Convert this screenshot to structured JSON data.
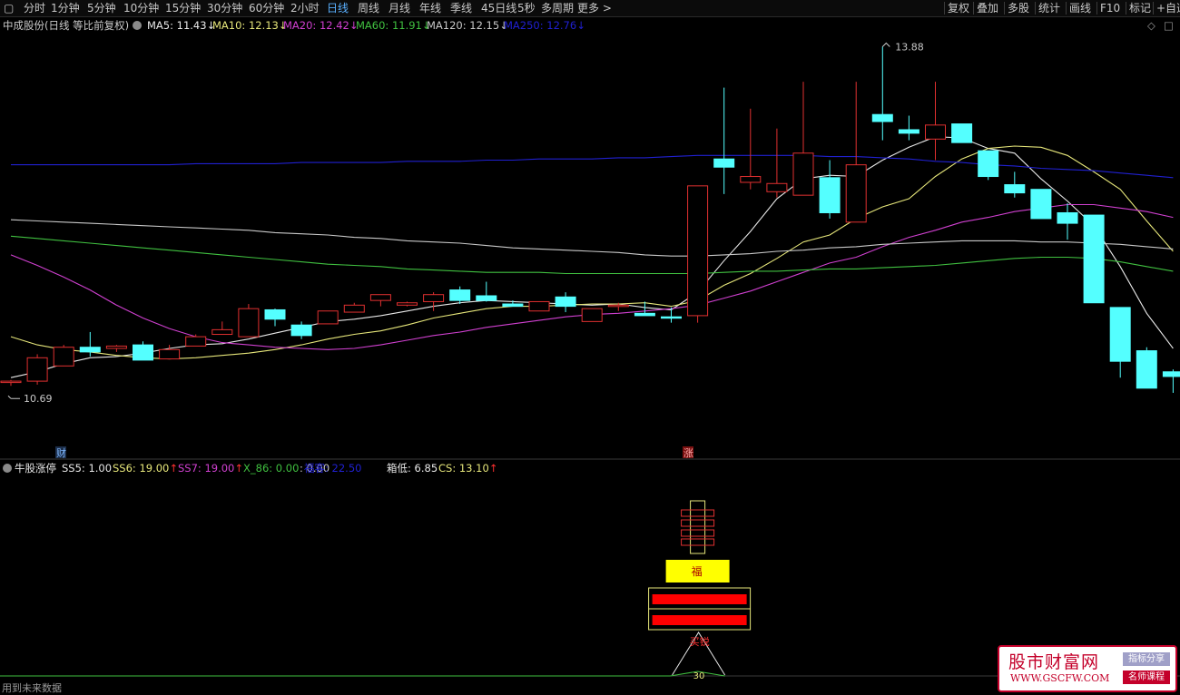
{
  "toolbar": {
    "periods": [
      "分时",
      "1分钟",
      "5分钟",
      "10分钟",
      "15分钟",
      "30分钟",
      "60分钟",
      "2小时",
      "日线",
      "周线",
      "月线",
      "年线",
      "季线",
      "45日线",
      "5秒",
      "多周期",
      "更多 >"
    ],
    "active_period": "日线",
    "right": [
      "复权",
      "叠加",
      "多股",
      "统计",
      "画线",
      "F10",
      "标记",
      "+自选"
    ]
  },
  "main_legend": {
    "title": "中成股份(日线 等比前复权)",
    "items": [
      {
        "text": "MA5: 11.43",
        "arrow": "↓",
        "color": "#e8e8e8"
      },
      {
        "text": "MA10: 12.13",
        "arrow": "↓",
        "color": "#e6e67a"
      },
      {
        "text": "MA20: 12.42",
        "arrow": "↓",
        "color": "#d040d0"
      },
      {
        "text": "MA60: 11.91",
        "arrow": "↓",
        "color": "#40c040"
      },
      {
        "text": "MA120: 12.15",
        "arrow": "↓",
        "color": "#c8c8c8"
      },
      {
        "text": "MA250: 12.76",
        "arrow": "↓",
        "color": "#2020d0"
      }
    ]
  },
  "sub_legend": {
    "title": "牛股涨停",
    "items": [
      {
        "text": "SS5: 1.00",
        "color": "#e8e8e8",
        "arrow": ""
      },
      {
        "text": "SS6: 19.00",
        "color": "#e6e67a",
        "arrow": "↑"
      },
      {
        "text": "SS7: 19.00",
        "color": "#d040d0",
        "arrow": "↑"
      },
      {
        "text": "X_86: 0.00",
        "color": "#40c040",
        "arrow": ""
      },
      {
        "text": ": 0.00",
        "color": "#c8c8c8",
        "arrow": ""
      },
      {
        "text": "福客: 22.50",
        "color": "#2020d0",
        "arrow": ""
      },
      {
        "text": "箱低: 6.85",
        "color": "#e8e8e8",
        "arrow": ""
      },
      {
        "text": "CS: 13.10",
        "color": "#e6e67a",
        "arrow": "↑"
      }
    ]
  },
  "annotations": {
    "high_label": "13.88",
    "low_label": "10.69",
    "cai": "财",
    "zhang": "涨",
    "buy": "买锐",
    "num30": "30",
    "fu": "福"
  },
  "status_text": "用到未来数据",
  "watermark": {
    "cn": "股市财富网",
    "url": "WWW.GSCFW.COM",
    "tag1": "指标分享",
    "tag2": "名师课程"
  },
  "colors": {
    "up": "#e03030",
    "down": "#54ffff",
    "bg": "#000000"
  },
  "chart_data": {
    "type": "candlestick",
    "title": "中成股份(日线 等比前复权)",
    "ylim": [
      10.4,
      14.0
    ],
    "candles": [
      {
        "o": 11.02,
        "h": 11.03,
        "l": 10.98,
        "c": 11.02
      },
      {
        "o": 11.02,
        "h": 11.25,
        "l": 10.99,
        "c": 11.22
      },
      {
        "o": 11.15,
        "h": 11.33,
        "l": 11.15,
        "c": 11.31
      },
      {
        "o": 11.31,
        "h": 11.44,
        "l": 11.23,
        "c": 11.27
      },
      {
        "o": 11.3,
        "h": 11.33,
        "l": 11.27,
        "c": 11.32
      },
      {
        "o": 11.33,
        "h": 11.36,
        "l": 11.2,
        "c": 11.2
      },
      {
        "o": 11.21,
        "h": 11.33,
        "l": 11.21,
        "c": 11.29
      },
      {
        "o": 11.32,
        "h": 11.42,
        "l": 11.32,
        "c": 11.4
      },
      {
        "o": 11.42,
        "h": 11.53,
        "l": 11.42,
        "c": 11.46
      },
      {
        "o": 11.4,
        "h": 11.68,
        "l": 11.4,
        "c": 11.64
      },
      {
        "o": 11.63,
        "h": 11.64,
        "l": 11.49,
        "c": 11.55
      },
      {
        "o": 11.5,
        "h": 11.53,
        "l": 11.38,
        "c": 11.41
      },
      {
        "o": 11.51,
        "h": 11.62,
        "l": 11.51,
        "c": 11.62
      },
      {
        "o": 11.61,
        "h": 11.69,
        "l": 11.61,
        "c": 11.67
      },
      {
        "o": 11.71,
        "h": 11.76,
        "l": 11.66,
        "c": 11.76
      },
      {
        "o": 11.67,
        "h": 11.7,
        "l": 11.66,
        "c": 11.69
      },
      {
        "o": 11.7,
        "h": 11.78,
        "l": 11.62,
        "c": 11.76
      },
      {
        "o": 11.8,
        "h": 11.83,
        "l": 11.68,
        "c": 11.71
      },
      {
        "o": 11.75,
        "h": 11.87,
        "l": 11.7,
        "c": 11.71
      },
      {
        "o": 11.68,
        "h": 11.71,
        "l": 11.66,
        "c": 11.66
      },
      {
        "o": 11.62,
        "h": 11.7,
        "l": 11.62,
        "c": 11.7
      },
      {
        "o": 11.74,
        "h": 11.78,
        "l": 11.61,
        "c": 11.66
      },
      {
        "o": 11.53,
        "h": 11.64,
        "l": 11.53,
        "c": 11.64
      },
      {
        "o": 11.66,
        "h": 11.69,
        "l": 11.62,
        "c": 11.67
      },
      {
        "o": 11.6,
        "h": 11.7,
        "l": 11.58,
        "c": 11.58
      },
      {
        "o": 11.57,
        "h": 11.65,
        "l": 11.52,
        "c": 11.56
      },
      {
        "o": 11.58,
        "h": 12.69,
        "l": 11.52,
        "c": 12.69
      },
      {
        "o": 12.92,
        "h": 13.53,
        "l": 12.62,
        "c": 12.85
      },
      {
        "o": 12.72,
        "h": 13.35,
        "l": 12.66,
        "c": 12.77
      },
      {
        "o": 12.64,
        "h": 13.18,
        "l": 12.59,
        "c": 12.71
      },
      {
        "o": 12.61,
        "h": 13.58,
        "l": 12.61,
        "c": 12.97
      },
      {
        "o": 12.76,
        "h": 12.91,
        "l": 12.41,
        "c": 12.46
      },
      {
        "o": 12.38,
        "h": 13.58,
        "l": 12.38,
        "c": 12.87
      },
      {
        "o": 13.3,
        "h": 13.88,
        "l": 13.08,
        "c": 13.24
      },
      {
        "o": 13.17,
        "h": 13.29,
        "l": 13.08,
        "c": 13.14
      },
      {
        "o": 13.09,
        "h": 13.58,
        "l": 12.91,
        "c": 13.21
      },
      {
        "o": 13.22,
        "h": 13.22,
        "l": 13.06,
        "c": 13.06
      },
      {
        "o": 12.99,
        "h": 12.99,
        "l": 12.74,
        "c": 12.77
      },
      {
        "o": 12.7,
        "h": 12.81,
        "l": 12.59,
        "c": 12.63
      },
      {
        "o": 12.66,
        "h": 12.66,
        "l": 12.41,
        "c": 12.41
      },
      {
        "o": 12.46,
        "h": 12.54,
        "l": 12.23,
        "c": 12.37
      },
      {
        "o": 12.44,
        "h": 12.44,
        "l": 11.69,
        "c": 11.69
      },
      {
        "o": 11.65,
        "h": 11.65,
        "l": 11.05,
        "c": 11.19
      },
      {
        "o": 11.28,
        "h": 11.31,
        "l": 10.96,
        "c": 10.96
      },
      {
        "o": 11.1,
        "h": 11.12,
        "l": 10.92,
        "c": 11.06
      }
    ],
    "ma_series": [
      {
        "name": "MA5",
        "color": "#e8e8e8",
        "values": [
          11.05,
          11.1,
          11.17,
          11.22,
          11.23,
          11.26,
          11.3,
          11.33,
          11.34,
          11.38,
          11.43,
          11.48,
          11.53,
          11.55,
          11.58,
          11.62,
          11.66,
          11.69,
          11.71,
          11.7,
          11.69,
          11.68,
          11.67,
          11.68,
          11.65,
          11.63,
          11.78,
          12.05,
          12.3,
          12.58,
          12.75,
          12.78,
          12.77,
          12.91,
          13.02,
          13.11,
          13.1,
          13.01,
          12.97,
          12.75,
          12.56,
          12.35,
          12.0,
          11.6,
          11.3
        ]
      },
      {
        "name": "MA10",
        "color": "#e6e67a",
        "values": [
          11.4,
          11.33,
          11.29,
          11.27,
          11.24,
          11.22,
          11.21,
          11.22,
          11.24,
          11.26,
          11.29,
          11.33,
          11.38,
          11.42,
          11.45,
          11.5,
          11.56,
          11.6,
          11.64,
          11.66,
          11.66,
          11.67,
          11.68,
          11.68,
          11.69,
          11.66,
          11.71,
          11.84,
          11.94,
          12.07,
          12.21,
          12.27,
          12.41,
          12.51,
          12.58,
          12.77,
          12.92,
          13.01,
          13.03,
          13.02,
          12.95,
          12.81,
          12.66,
          12.39,
          12.13
        ]
      },
      {
        "name": "MA20",
        "color": "#d040d0",
        "values": [
          12.1,
          12.01,
          11.91,
          11.8,
          11.67,
          11.56,
          11.47,
          11.4,
          11.35,
          11.33,
          11.31,
          11.3,
          11.29,
          11.3,
          11.33,
          11.37,
          11.41,
          11.44,
          11.48,
          11.51,
          11.54,
          11.57,
          11.59,
          11.6,
          11.62,
          11.64,
          11.67,
          11.73,
          11.79,
          11.87,
          11.95,
          12.03,
          12.08,
          12.17,
          12.25,
          12.31,
          12.38,
          12.42,
          12.47,
          12.5,
          12.53,
          12.53,
          12.5,
          12.47,
          12.42
        ]
      },
      {
        "name": "MA60",
        "color": "#40c040",
        "values": [
          12.26,
          12.24,
          12.22,
          12.2,
          12.18,
          12.16,
          12.14,
          12.12,
          12.1,
          12.08,
          12.06,
          12.04,
          12.02,
          12.01,
          12.0,
          11.98,
          11.97,
          11.96,
          11.95,
          11.95,
          11.95,
          11.94,
          11.94,
          11.94,
          11.94,
          11.94,
          11.94,
          11.95,
          11.96,
          11.96,
          11.97,
          11.98,
          11.98,
          11.99,
          12.0,
          12.01,
          12.03,
          12.05,
          12.07,
          12.08,
          12.08,
          12.07,
          12.04,
          12.0,
          11.96
        ]
      },
      {
        "name": "MA120",
        "color": "#c8c8c8",
        "values": [
          12.4,
          12.39,
          12.38,
          12.37,
          12.36,
          12.35,
          12.34,
          12.33,
          12.32,
          12.31,
          12.29,
          12.28,
          12.27,
          12.25,
          12.24,
          12.22,
          12.21,
          12.2,
          12.18,
          12.16,
          12.15,
          12.14,
          12.13,
          12.12,
          12.1,
          12.09,
          12.09,
          12.1,
          12.11,
          12.13,
          12.14,
          12.16,
          12.17,
          12.19,
          12.2,
          12.21,
          12.22,
          12.22,
          12.22,
          12.21,
          12.21,
          12.2,
          12.19,
          12.17,
          12.15
        ]
      },
      {
        "name": "MA250",
        "color": "#2020d0",
        "values": [
          12.87,
          12.87,
          12.87,
          12.87,
          12.87,
          12.87,
          12.87,
          12.88,
          12.88,
          12.88,
          12.88,
          12.89,
          12.89,
          12.89,
          12.89,
          12.9,
          12.9,
          12.9,
          12.91,
          12.91,
          12.92,
          12.92,
          12.92,
          12.93,
          12.93,
          12.94,
          12.95,
          12.95,
          12.95,
          12.95,
          12.95,
          12.94,
          12.94,
          12.93,
          12.92,
          12.9,
          12.89,
          12.87,
          12.86,
          12.84,
          12.83,
          12.82,
          12.8,
          12.78,
          12.76
        ]
      }
    ]
  }
}
